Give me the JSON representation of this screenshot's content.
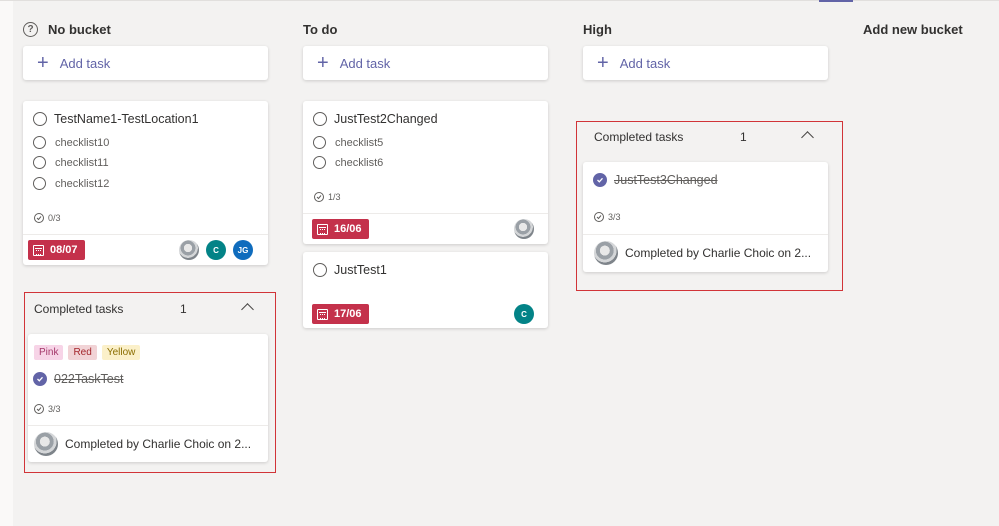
{
  "buckets": [
    {
      "name": "No bucket"
    },
    {
      "name": "To do"
    },
    {
      "name": "High"
    }
  ],
  "add_bucket_label": "Add new bucket",
  "add_task_label": "Add task",
  "colors": {
    "accent": "#6264a7",
    "overdue": "#c4314b",
    "highlight_box": "#d13438"
  },
  "cards": {
    "c1": {
      "title": "TestName1-TestLocation1",
      "checklist": [
        "checklist10",
        "checklist11",
        "checklist12"
      ],
      "progress": "0/3",
      "due": "08/07",
      "assignees": [
        {
          "type": "photo"
        },
        {
          "initials": "C"
        },
        {
          "initials": "JG"
        }
      ]
    },
    "c2": {
      "title": "JustTest2Changed",
      "checklist": [
        "checklist5",
        "checklist6"
      ],
      "progress": "1/3",
      "due": "16/06"
    },
    "c3": {
      "title": "JustTest1",
      "due": "17/06",
      "assignee": "C"
    }
  },
  "completed": {
    "header": "Completed tasks",
    "no_bucket": {
      "count": "1",
      "labels": [
        "Pink",
        "Red",
        "Yellow"
      ],
      "title": "022TaskTest",
      "progress": "3/3",
      "completed_by": "Completed by Charlie Choic on 2..."
    },
    "high": {
      "count": "1",
      "title": "JustTest3Changed",
      "progress": "3/3",
      "completed_by": "Completed by Charlie Choic on 2..."
    }
  }
}
